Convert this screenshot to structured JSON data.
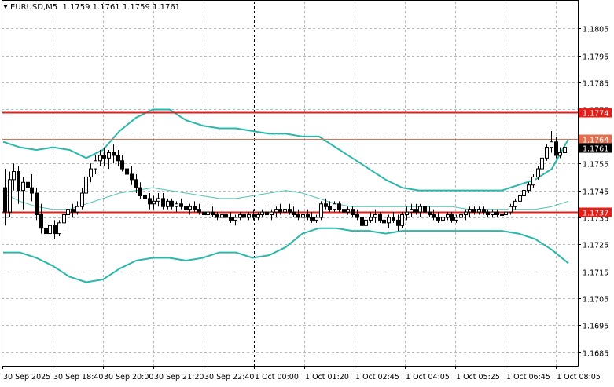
{
  "chart_data": {
    "type": "candlestick",
    "symbol_line": {
      "symbol": "EURUSD,M5",
      "open": "1.1759",
      "high": "1.1761",
      "low": "1.1759",
      "close": "1.1761"
    },
    "ylim": [
      1.168,
      1.1815
    ],
    "y_ticks": [
      "1.1805",
      "1.1795",
      "1.1785",
      "1.1775",
      "1.1765",
      "1.1755",
      "1.1745",
      "1.1735",
      "1.1725",
      "1.1715",
      "1.1705",
      "1.1695",
      "1.1685"
    ],
    "x_ticks": [
      "30 Sep 2025",
      "30 Sep 18:40",
      "30 Sep 20:00",
      "30 Sep 21:20",
      "30 Sep 22:40",
      "1 Oct 00:00",
      "1 Oct 01:20",
      "1 Oct 02:45",
      "1 Oct 04:05",
      "1 Oct 05:25",
      "1 Oct 06:45",
      "1 Oct 08:05"
    ],
    "grid": true,
    "horizontal_levels": [
      {
        "value": 1.1774,
        "label": "1.1774",
        "color": "#e0201a"
      },
      {
        "value": 1.1764,
        "label": "1.1764",
        "color": "#e07050"
      },
      {
        "value": 1.1737,
        "label": "1.1737",
        "color": "#e0201a"
      }
    ],
    "current_price": {
      "value": 1.1761,
      "label": "1.1761",
      "color": "#000000"
    },
    "colors": {
      "bollinger": "#2ab8a8",
      "middle_band": "#4cc4b4",
      "candle": "#000000",
      "grid": "#b8b8b8"
    },
    "candles": [
      [
        1.1746,
        1.1753,
        1.1732,
        1.1737
      ],
      [
        1.1737,
        1.1752,
        1.1735,
        1.1749
      ],
      [
        1.1749,
        1.1755,
        1.1745,
        1.1752
      ],
      [
        1.1752,
        1.1754,
        1.174,
        1.1745
      ],
      [
        1.1745,
        1.175,
        1.1738,
        1.1748
      ],
      [
        1.1748,
        1.1752,
        1.1742,
        1.1746
      ],
      [
        1.1746,
        1.1751,
        1.1741,
        1.1744
      ],
      [
        1.1744,
        1.1746,
        1.1734,
        1.1736
      ],
      [
        1.1736,
        1.174,
        1.1729,
        1.1731
      ],
      [
        1.1731,
        1.1734,
        1.1727,
        1.1729
      ],
      [
        1.1729,
        1.1733,
        1.1728,
        1.1732
      ],
      [
        1.1732,
        1.1734,
        1.1727,
        1.1729
      ],
      [
        1.1729,
        1.1734,
        1.1728,
        1.1733
      ],
      [
        1.1733,
        1.1738,
        1.173,
        1.1736
      ],
      [
        1.1736,
        1.174,
        1.1734,
        1.1738
      ],
      [
        1.1738,
        1.174,
        1.1735,
        1.1737
      ],
      [
        1.1737,
        1.1741,
        1.1736,
        1.1739
      ],
      [
        1.1739,
        1.1746,
        1.1738,
        1.1744
      ],
      [
        1.1744,
        1.1752,
        1.1742,
        1.175
      ],
      [
        1.175,
        1.1755,
        1.1748,
        1.1753
      ],
      [
        1.1753,
        1.1758,
        1.1751,
        1.1756
      ],
      [
        1.1756,
        1.176,
        1.1754,
        1.1758
      ],
      [
        1.1758,
        1.1761,
        1.1754,
        1.1757
      ],
      [
        1.1757,
        1.176,
        1.1753,
        1.1759
      ],
      [
        1.1759,
        1.1762,
        1.1755,
        1.1758
      ],
      [
        1.1758,
        1.176,
        1.1754,
        1.1756
      ],
      [
        1.1756,
        1.1758,
        1.1752,
        1.1753
      ],
      [
        1.1753,
        1.1755,
        1.1749,
        1.1751
      ],
      [
        1.1751,
        1.1754,
        1.1747,
        1.1749
      ],
      [
        1.1749,
        1.1751,
        1.1744,
        1.1746
      ],
      [
        1.1746,
        1.1748,
        1.1742,
        1.1743
      ],
      [
        1.1743,
        1.1745,
        1.174,
        1.1742
      ],
      [
        1.1742,
        1.1744,
        1.1738,
        1.174
      ],
      [
        1.174,
        1.1743,
        1.1738,
        1.1741
      ],
      [
        1.1741,
        1.1744,
        1.1739,
        1.1742
      ],
      [
        1.1742,
        1.1744,
        1.1738,
        1.1739
      ],
      [
        1.1739,
        1.1742,
        1.1738,
        1.1741
      ],
      [
        1.1741,
        1.1742,
        1.1738,
        1.1739
      ],
      [
        1.1739,
        1.1741,
        1.1737,
        1.174
      ],
      [
        1.174,
        1.1742,
        1.1738,
        1.1739
      ],
      [
        1.1739,
        1.1741,
        1.1737,
        1.1738
      ],
      [
        1.1738,
        1.174,
        1.1736,
        1.1739
      ],
      [
        1.1739,
        1.1741,
        1.1737,
        1.1738
      ],
      [
        1.1738,
        1.174,
        1.1736,
        1.1737
      ],
      [
        1.1737,
        1.1739,
        1.1735,
        1.1736
      ],
      [
        1.1736,
        1.1738,
        1.1734,
        1.1737
      ],
      [
        1.1737,
        1.1739,
        1.1735,
        1.1736
      ],
      [
        1.1736,
        1.1737,
        1.1734,
        1.1735
      ],
      [
        1.1735,
        1.1737,
        1.1734,
        1.1736
      ],
      [
        1.1736,
        1.1737,
        1.1734,
        1.1735
      ],
      [
        1.1735,
        1.1737,
        1.1733,
        1.1734
      ],
      [
        1.1734,
        1.1736,
        1.1732,
        1.1735
      ],
      [
        1.1735,
        1.1737,
        1.1734,
        1.1736
      ],
      [
        1.1736,
        1.1737,
        1.1734,
        1.1735
      ],
      [
        1.1735,
        1.1737,
        1.1734,
        1.1736
      ],
      [
        1.1736,
        1.1738,
        1.1734,
        1.1735
      ],
      [
        1.1735,
        1.1737,
        1.1734,
        1.1736
      ],
      [
        1.1736,
        1.1738,
        1.1735,
        1.1737
      ],
      [
        1.1737,
        1.1739,
        1.1735,
        1.1736
      ],
      [
        1.1736,
        1.1738,
        1.1734,
        1.1737
      ],
      [
        1.1737,
        1.1739,
        1.1735,
        1.1738
      ],
      [
        1.1738,
        1.174,
        1.1736,
        1.1737
      ],
      [
        1.1737,
        1.1743,
        1.1735,
        1.1738
      ],
      [
        1.1738,
        1.174,
        1.1736,
        1.1737
      ],
      [
        1.1737,
        1.1739,
        1.1735,
        1.1736
      ],
      [
        1.1736,
        1.1738,
        1.1734,
        1.1735
      ],
      [
        1.1735,
        1.1737,
        1.1734,
        1.1736
      ],
      [
        1.1736,
        1.1738,
        1.1734,
        1.1735
      ],
      [
        1.1735,
        1.1737,
        1.1733,
        1.1734
      ],
      [
        1.1734,
        1.1736,
        1.1733,
        1.1735
      ],
      [
        1.1735,
        1.1741,
        1.1734,
        1.174
      ],
      [
        1.174,
        1.1742,
        1.1738,
        1.1739
      ],
      [
        1.1739,
        1.1741,
        1.1737,
        1.1738
      ],
      [
        1.1738,
        1.1741,
        1.1737,
        1.174
      ],
      [
        1.174,
        1.1741,
        1.1737,
        1.1738
      ],
      [
        1.1738,
        1.174,
        1.1736,
        1.1737
      ],
      [
        1.1737,
        1.1739,
        1.1736,
        1.1738
      ],
      [
        1.1738,
        1.1739,
        1.1735,
        1.1736
      ],
      [
        1.1736,
        1.1738,
        1.1734,
        1.1735
      ],
      [
        1.1735,
        1.1736,
        1.1731,
        1.1732
      ],
      [
        1.1732,
        1.1735,
        1.173,
        1.1734
      ],
      [
        1.1734,
        1.1737,
        1.1733,
        1.1735
      ],
      [
        1.1735,
        1.1738,
        1.1733,
        1.1736
      ],
      [
        1.1736,
        1.1737,
        1.1733,
        1.1734
      ],
      [
        1.1734,
        1.1736,
        1.1732,
        1.1733
      ],
      [
        1.1733,
        1.1736,
        1.1731,
        1.1735
      ],
      [
        1.1735,
        1.1737,
        1.1733,
        1.1734
      ],
      [
        1.1734,
        1.1736,
        1.173,
        1.1732
      ],
      [
        1.1732,
        1.1737,
        1.1731,
        1.1736
      ],
      [
        1.1736,
        1.1739,
        1.1734,
        1.1737
      ],
      [
        1.1737,
        1.174,
        1.1735,
        1.1738
      ],
      [
        1.1738,
        1.174,
        1.1736,
        1.1737
      ],
      [
        1.1737,
        1.174,
        1.1735,
        1.1739
      ],
      [
        1.1739,
        1.174,
        1.1736,
        1.1737
      ],
      [
        1.1737,
        1.1739,
        1.1735,
        1.1736
      ],
      [
        1.1736,
        1.1738,
        1.1734,
        1.1735
      ],
      [
        1.1735,
        1.1737,
        1.1733,
        1.1734
      ],
      [
        1.1734,
        1.1736,
        1.1733,
        1.1735
      ],
      [
        1.1735,
        1.1737,
        1.1734,
        1.1736
      ],
      [
        1.1736,
        1.1737,
        1.1733,
        1.1734
      ],
      [
        1.1734,
        1.1736,
        1.1733,
        1.1735
      ],
      [
        1.1735,
        1.1737,
        1.1734,
        1.1736
      ],
      [
        1.1736,
        1.1738,
        1.1734,
        1.1737
      ],
      [
        1.1737,
        1.1739,
        1.1735,
        1.1738
      ],
      [
        1.1738,
        1.1739,
        1.1736,
        1.1737
      ],
      [
        1.1737,
        1.1739,
        1.1736,
        1.1738
      ],
      [
        1.1738,
        1.1739,
        1.1736,
        1.1737
      ],
      [
        1.1737,
        1.1738,
        1.1735,
        1.1736
      ],
      [
        1.1736,
        1.1738,
        1.1735,
        1.1737
      ],
      [
        1.1737,
        1.1738,
        1.1735,
        1.1736
      ],
      [
        1.1736,
        1.1737,
        1.1735,
        1.1736
      ],
      [
        1.1736,
        1.1738,
        1.1735,
        1.1737
      ],
      [
        1.1737,
        1.174,
        1.1736,
        1.1739
      ],
      [
        1.1739,
        1.1742,
        1.1738,
        1.1741
      ],
      [
        1.1741,
        1.1744,
        1.174,
        1.1743
      ],
      [
        1.1743,
        1.1746,
        1.1742,
        1.1745
      ],
      [
        1.1745,
        1.1748,
        1.1744,
        1.1747
      ],
      [
        1.1747,
        1.1751,
        1.1746,
        1.175
      ],
      [
        1.175,
        1.1754,
        1.1749,
        1.1753
      ],
      [
        1.1753,
        1.1758,
        1.1752,
        1.1757
      ],
      [
        1.1757,
        1.1762,
        1.1756,
        1.1761
      ],
      [
        1.1761,
        1.1767,
        1.1759,
        1.1763
      ],
      [
        1.1763,
        1.1765,
        1.1757,
        1.1758
      ],
      [
        1.1758,
        1.1761,
        1.1757,
        1.1759
      ],
      [
        1.1759,
        1.1761,
        1.1759,
        1.1761
      ]
    ],
    "bollinger_upper": [
      1.1763,
      1.1761,
      1.176,
      1.1761,
      1.176,
      1.1757,
      1.176,
      1.1767,
      1.1772,
      1.1775,
      1.1775,
      1.1771,
      1.1769,
      1.1768,
      1.1768,
      1.1767,
      1.1766,
      1.1766,
      1.1765,
      1.1765,
      1.1761,
      1.1757,
      1.1753,
      1.1749,
      1.1746,
      1.1745,
      1.1745,
      1.1745,
      1.1745,
      1.1745,
      1.1745,
      1.1747,
      1.1749,
      1.1753,
      1.1764
    ],
    "bollinger_middle": [
      1.1744,
      1.1741,
      1.1739,
      1.1738,
      1.1738,
      1.174,
      1.1742,
      1.1744,
      1.1745,
      1.1746,
      1.1745,
      1.1744,
      1.1743,
      1.1742,
      1.1742,
      1.1743,
      1.1744,
      1.1745,
      1.1744,
      1.1742,
      1.174,
      1.1739,
      1.1739,
      1.1739,
      1.1739,
      1.1739,
      1.1739,
      1.1739,
      1.1738,
      1.1738,
      1.1738,
      1.1738,
      1.1738,
      1.1739,
      1.1741
    ],
    "bollinger_lower": [
      1.1722,
      1.1722,
      1.172,
      1.1717,
      1.1713,
      1.1711,
      1.1712,
      1.1716,
      1.1719,
      1.172,
      1.172,
      1.1719,
      1.172,
      1.1722,
      1.1722,
      1.172,
      1.1721,
      1.1724,
      1.1729,
      1.1731,
      1.1731,
      1.173,
      1.173,
      1.1729,
      1.173,
      1.173,
      1.173,
      1.173,
      1.173,
      1.173,
      1.173,
      1.1729,
      1.1727,
      1.1723,
      1.1718
    ]
  }
}
